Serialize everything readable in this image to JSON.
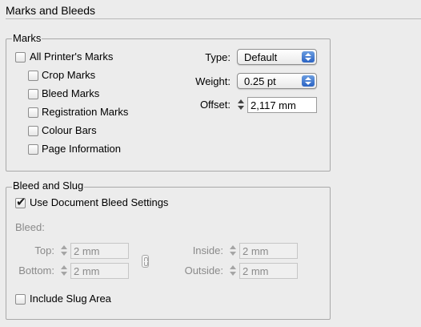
{
  "section_title": "Marks and Bleeds",
  "marks": {
    "group_label": "Marks",
    "all_printers_marks": {
      "label": "All Printer's Marks",
      "checked": false
    },
    "items": [
      {
        "label": "Crop Marks",
        "checked": false
      },
      {
        "label": "Bleed Marks",
        "checked": false
      },
      {
        "label": "Registration Marks",
        "checked": false
      },
      {
        "label": "Colour Bars",
        "checked": false
      },
      {
        "label": "Page Information",
        "checked": false
      }
    ],
    "type": {
      "label": "Type:",
      "value": "Default"
    },
    "weight": {
      "label": "Weight:",
      "value": "0.25 pt"
    },
    "offset": {
      "label": "Offset:",
      "value": "2,117 mm"
    }
  },
  "bleed_slug": {
    "group_label": "Bleed and Slug",
    "use_document_bleed": {
      "label": "Use Document Bleed Settings",
      "checked": true
    },
    "bleed_label": "Bleed:",
    "top": {
      "label": "Top:",
      "value": "2 mm"
    },
    "bottom": {
      "label": "Bottom:",
      "value": "2 mm"
    },
    "inside": {
      "label": "Inside:",
      "value": "2 mm"
    },
    "outside": {
      "label": "Outside:",
      "value": "2 mm"
    },
    "include_slug": {
      "label": "Include Slug Area",
      "checked": false
    }
  },
  "icons": {
    "stepper": "stepper-arrows-icon",
    "popup": "popup-arrows-icon",
    "link": "chain-link-icon"
  }
}
